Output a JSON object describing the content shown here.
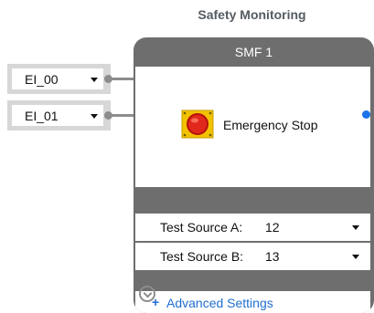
{
  "section": {
    "title": "Safety Monitoring"
  },
  "inputs": [
    {
      "value": "EI_00"
    },
    {
      "value": "EI_01"
    }
  ],
  "block": {
    "title": "SMF 1",
    "function_label": "Emergency Stop",
    "function_icon": "emergency-stop-icon",
    "output_color": "#1a73e8",
    "header_color": "#6e6e6e"
  },
  "params": [
    {
      "label": "Test Source A:",
      "value": "12"
    },
    {
      "label": "Test Source B:",
      "value": "13"
    }
  ],
  "advanced": {
    "plus": "+",
    "label": "Advanced Settings",
    "link_color": "#1f6fd1"
  }
}
